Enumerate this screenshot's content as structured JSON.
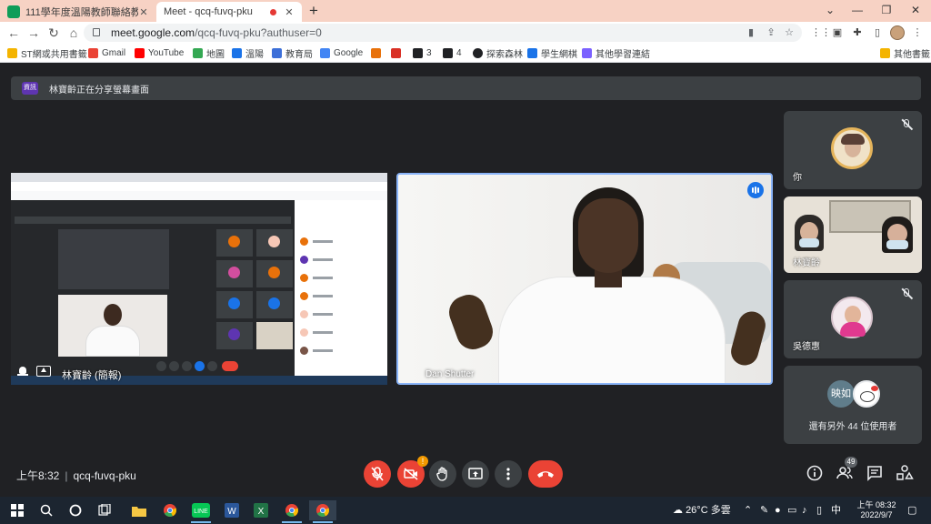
{
  "browser": {
    "tabs": [
      {
        "title": "111學年度溫陽教師聯絡教室",
        "active": false
      },
      {
        "title": "Meet - qcq-fuvq-pku",
        "active": true
      }
    ],
    "url_host": "meet.google.com",
    "url_path": "/qcq-fuvq-pku?authuser=0",
    "bookmarks": [
      {
        "label": "ST網或共用書籤",
        "color": "#f4b400"
      },
      {
        "label": "Gmail",
        "color": "#ea4335"
      },
      {
        "label": "YouTube",
        "color": "#ff0000"
      },
      {
        "label": "地圖",
        "color": "#34a853"
      },
      {
        "label": "溫陽",
        "color": "#1a73e8"
      },
      {
        "label": "教育局",
        "color": "#3c6fd8"
      },
      {
        "label": "Google",
        "color": "#4285f4"
      },
      {
        "label": "",
        "color": "#e8710a"
      },
      {
        "label": "",
        "color": "#d93025"
      },
      {
        "label": "3",
        "color": "#202124"
      },
      {
        "label": "4",
        "color": "#202124"
      },
      {
        "label": "探索森林",
        "color": "#202124"
      },
      {
        "label": "學生網棋",
        "color": "#1a73e8"
      },
      {
        "label": "其他學習連結",
        "color": "#7b61ff"
      }
    ],
    "other_bookmarks": "其他書籤"
  },
  "meet": {
    "share_badge": "資訊",
    "share_banner": "林寶齡正在分享螢幕畫面",
    "presenter_label": "林寶齡 (簡報)",
    "speaker_name": "Dan Shutter",
    "side_tiles": [
      {
        "name": "你",
        "muted": true
      },
      {
        "name": "林寶齡",
        "muted": false
      },
      {
        "name": "吳德惠",
        "muted": true
      }
    ],
    "others_initial": "映如",
    "others_text": "還有另外 44 位使用者",
    "time": "上午8:32",
    "meeting_code": "qcq-fuvq-pku",
    "alert_count": "!",
    "participant_count": "49"
  },
  "taskbar": {
    "weather": "26°C 多雲",
    "time": "上午 08:32",
    "date": "2022/9/7"
  }
}
